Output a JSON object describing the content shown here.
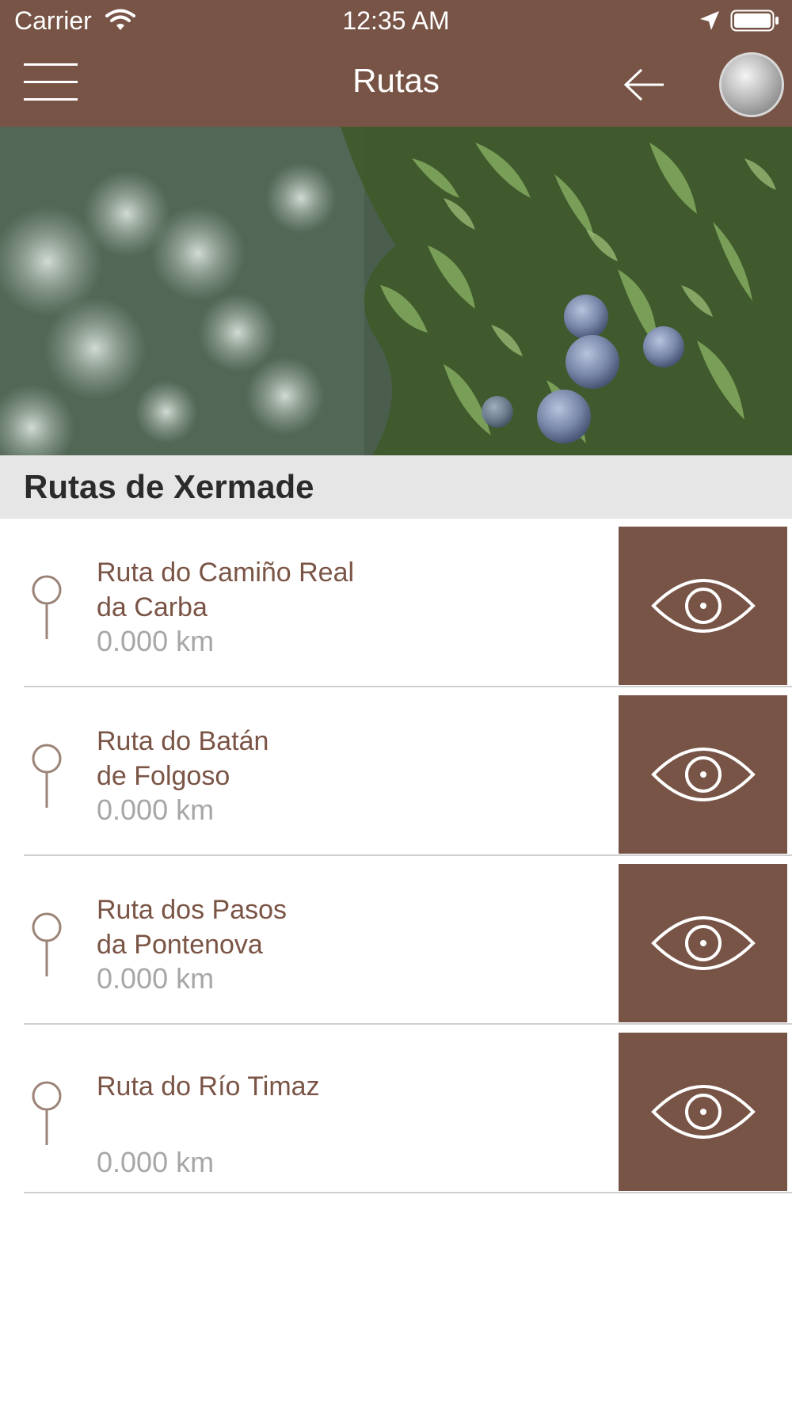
{
  "status_bar": {
    "carrier": "Carrier",
    "time": "12:35 AM",
    "wifi_icon": "wifi-icon",
    "location_icon": "location-arrow-icon",
    "battery_icon": "battery-icon"
  },
  "nav": {
    "title": "Rutas",
    "menu_icon": "hamburger-menu-icon",
    "back_icon": "arrow-left-icon",
    "avatar": "user-avatar"
  },
  "hero": {
    "image": "juniper-branch-with-berries-photo"
  },
  "section": {
    "title": "Rutas de Xermade"
  },
  "routes": [
    {
      "name_line1": "Ruta do Camiño Real",
      "name_line2": "da Carba",
      "distance": "0.000 km"
    },
    {
      "name_line1": "Ruta do Batán",
      "name_line2": "de Folgoso",
      "distance": "0.000 km"
    },
    {
      "name_line1": "Ruta dos Pasos",
      "name_line2": "da Pontenova",
      "distance": "0.000 km"
    },
    {
      "name_line1": "Ruta do Río Timaz",
      "distance": "0.000 km"
    }
  ],
  "colors": {
    "brand": "#785446",
    "route_text": "#7a5445",
    "distance_text": "#a7a7a7",
    "section_bg": "#e6e6e6",
    "header_text": "#2b2b2b"
  }
}
